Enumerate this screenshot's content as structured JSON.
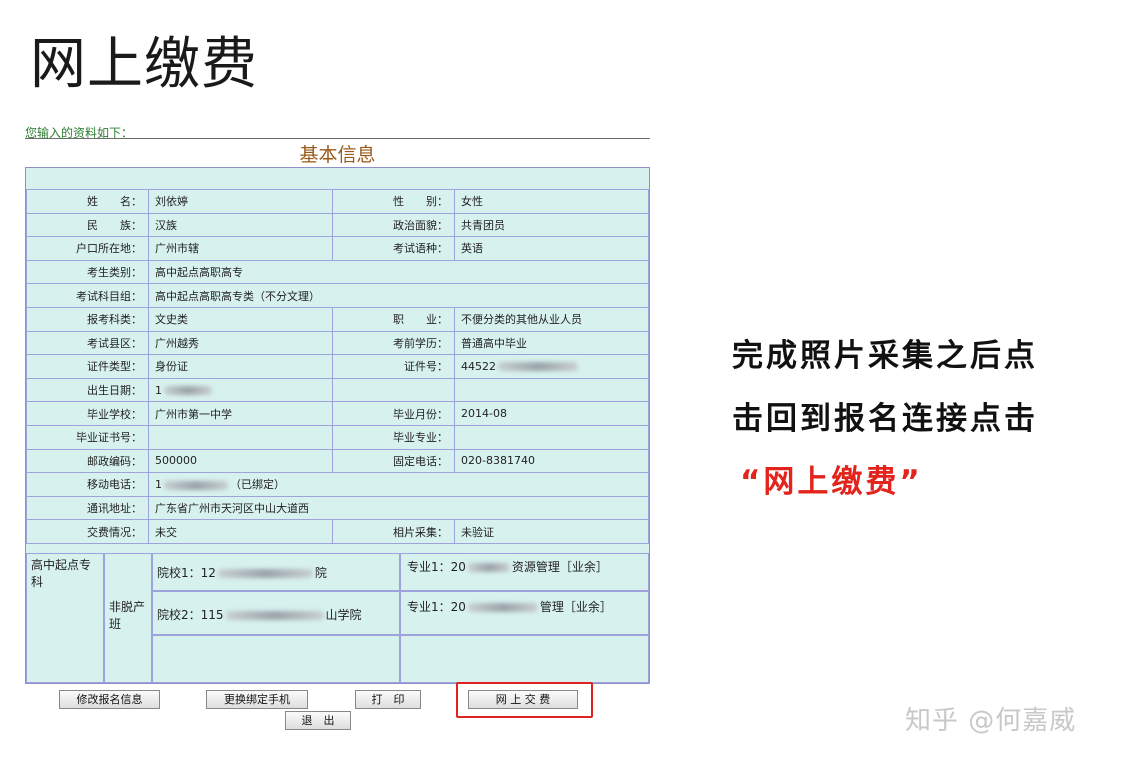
{
  "page_title": "网上缴费",
  "intro_text": "您输入的资料如下：",
  "section_title": "基本信息",
  "rows": [
    {
      "l1": "姓　　名：",
      "v1": "刘依婷",
      "l2": "性　　别：",
      "v2": "女性"
    },
    {
      "l1": "民　　族：",
      "v1": "汉族",
      "l2": "政治面貌：",
      "v2": "共青团员"
    },
    {
      "l1": "户口所在地：",
      "v1": "广州市辖",
      "l2": "考试语种：",
      "v2": "英语"
    },
    {
      "l1": "考生类别：",
      "v1": "高中起点高职高专"
    },
    {
      "l1": "考试科目组：",
      "v1": "高中起点高职高专类（不分文理）"
    },
    {
      "l1": "报考科类：",
      "v1": "文史类",
      "l2": "职　　业：",
      "v2": "不便分类的其他从业人员"
    },
    {
      "l1": "考试县区：",
      "v1": "广州越秀",
      "l2": "考前学历：",
      "v2": "普通高中毕业"
    },
    {
      "l1": "证件类型：",
      "v1": "身份证",
      "l2": "证件号：",
      "v2": "44522"
    },
    {
      "l1": "出生日期：",
      "v1": "1",
      "l2": "",
      "v2": ""
    },
    {
      "l1": "毕业学校：",
      "v1": "广州市第一中学",
      "l2": "毕业月份：",
      "v2": "2014-08"
    },
    {
      "l1": "毕业证书号：",
      "v1": "",
      "l2": "毕业专业：",
      "v2": ""
    },
    {
      "l1": "邮政编码：",
      "v1": "500000",
      "l2": "固定电话：",
      "v2": "020-8381740"
    },
    {
      "l1": "移动电话：",
      "v1": "1",
      "v1b": "（已绑定）"
    },
    {
      "l1": "通讯地址：",
      "v1": "广东省广州市天河区中山大道西"
    },
    {
      "l1": "交费情况：",
      "v1": "未交",
      "l2": "相片采集：",
      "v2": "未验证"
    }
  ],
  "bottom": {
    "level_label": "高中起点专科",
    "mode_label": "非脱产班",
    "school1_prefix": "院校1：12",
    "school1_suffix": "院",
    "major1_prefix": "专业1：20",
    "major1_suffix": "资源管理［业余］",
    "school2_prefix": "院校2：115",
    "school2_suffix": "山学院",
    "major2_prefix": "专业1：20",
    "major2_suffix": "管理［业余］"
  },
  "buttons": {
    "edit": "修改报名信息",
    "change_phone": "更换绑定手机",
    "print": "打　印",
    "pay": "网 上 交 费",
    "exit": "退　出"
  },
  "side_note": {
    "line1": "完成照片采集之后点",
    "line2": "击回到报名连接点击",
    "line3": "“网上缴费”"
  },
  "watermark": "知乎 @何嘉威"
}
